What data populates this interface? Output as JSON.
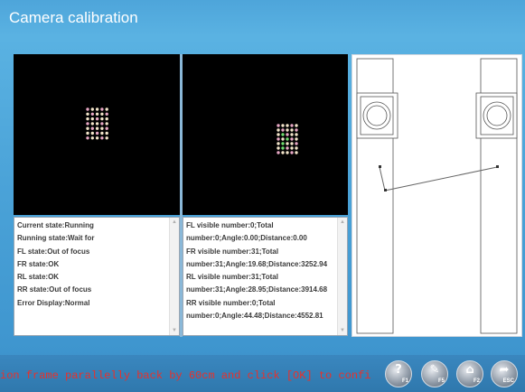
{
  "window": {
    "title": "Camera calibration"
  },
  "left_log": {
    "lines": [
      "Current state:Running",
      "Running state:Wait for",
      "FL state:Out of focus",
      "FR state:OK",
      "RL state:OK",
      "RR state:Out of focus",
      "Error Display:Normal"
    ]
  },
  "right_log": {
    "lines": [
      "FL visible number:0;Total",
      "number:0;Angle:0.00;Distance:0.00",
      "FR visible number:31;Total",
      "number:31;Angle:19.68;Distance:3252.94",
      "RL visible number:31;Total",
      "number:31;Angle:28.95;Distance:3914.68",
      "RR visible number:0;Total",
      "number:0;Angle:44.48;Distance:4552.81"
    ]
  },
  "status": {
    "message": "ion frame parallelly back by 60cm and click [OK] to confi",
    "color": "#e8312b"
  },
  "buttons": [
    {
      "key": "F1",
      "icon": "help-icon"
    },
    {
      "key": "F5",
      "icon": "tools-icon"
    },
    {
      "key": "F2",
      "icon": "car-icon"
    },
    {
      "key": "ESC",
      "icon": "back-arrow-icon"
    }
  ],
  "colors": {
    "accent": "#4ea5da",
    "panel_bg": "#000000",
    "text": "#3a3a3a"
  }
}
